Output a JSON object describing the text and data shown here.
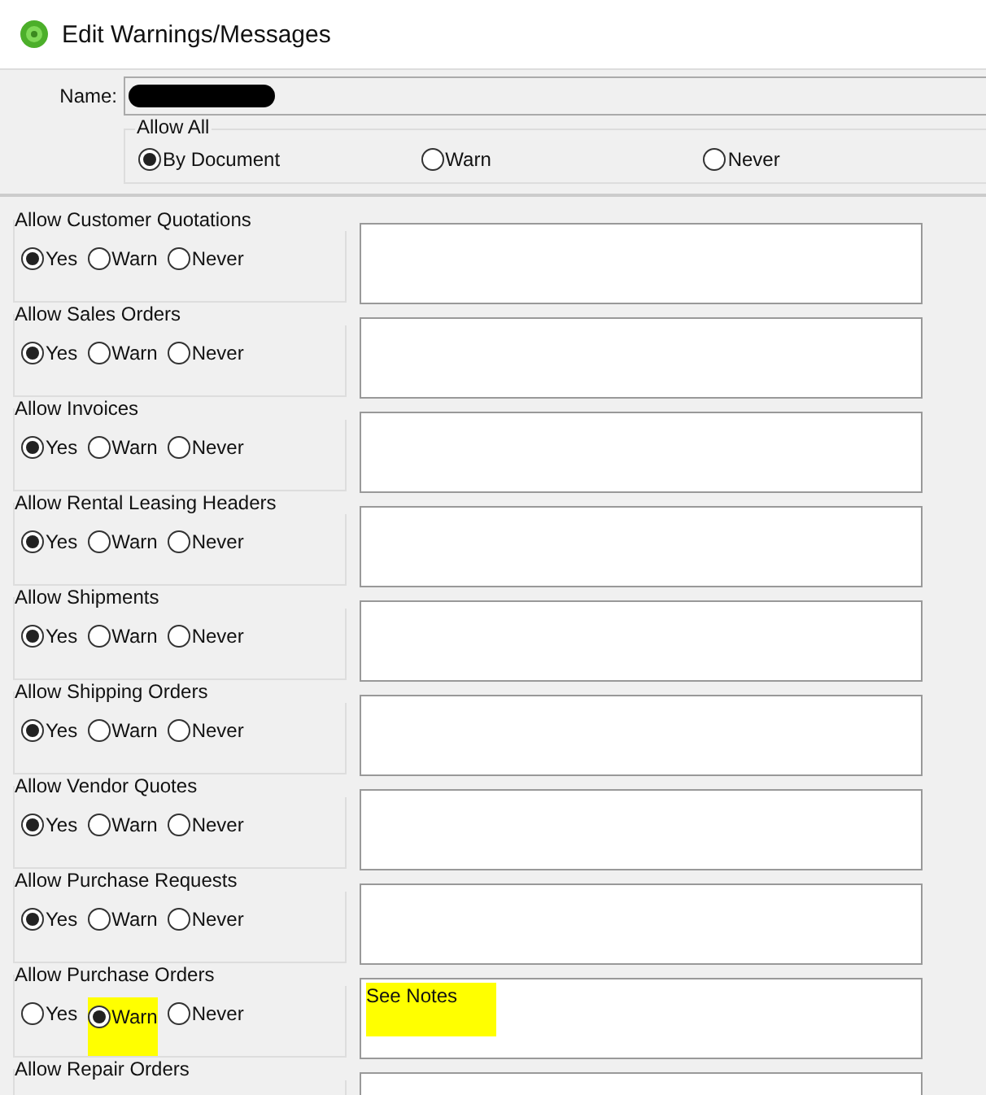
{
  "window": {
    "title": "Edit Warnings/Messages"
  },
  "name_field": {
    "label": "Name:"
  },
  "allow_all": {
    "legend": "Allow All",
    "options": [
      {
        "label": "By Document",
        "selected": true
      },
      {
        "label": "Warn",
        "selected": false
      },
      {
        "label": "Never",
        "selected": false
      }
    ]
  },
  "documents": [
    {
      "label": "Allow Customer Quotations",
      "options": [
        {
          "label": "Yes",
          "selected": true
        },
        {
          "label": "Warn",
          "selected": false
        },
        {
          "label": "Never",
          "selected": false
        }
      ]
    },
    {
      "label": "Allow Sales Orders",
      "options": [
        {
          "label": "Yes",
          "selected": true
        },
        {
          "label": "Warn",
          "selected": false
        },
        {
          "label": "Never",
          "selected": false
        }
      ]
    },
    {
      "label": "Allow Invoices",
      "options": [
        {
          "label": "Yes",
          "selected": true
        },
        {
          "label": "Warn",
          "selected": false
        },
        {
          "label": "Never",
          "selected": false
        }
      ]
    },
    {
      "label": "Allow Rental Leasing Headers",
      "options": [
        {
          "label": "Yes",
          "selected": true
        },
        {
          "label": "Warn",
          "selected": false
        },
        {
          "label": "Never",
          "selected": false
        }
      ]
    },
    {
      "label": "Allow Shipments",
      "options": [
        {
          "label": "Yes",
          "selected": true
        },
        {
          "label": "Warn",
          "selected": false
        },
        {
          "label": "Never",
          "selected": false
        }
      ]
    },
    {
      "label": "Allow Shipping Orders",
      "options": [
        {
          "label": "Yes",
          "selected": true
        },
        {
          "label": "Warn",
          "selected": false
        },
        {
          "label": "Never",
          "selected": false
        }
      ]
    },
    {
      "label": "Allow Vendor Quotes",
      "options": [
        {
          "label": "Yes",
          "selected": true
        },
        {
          "label": "Warn",
          "selected": false
        },
        {
          "label": "Never",
          "selected": false
        }
      ]
    },
    {
      "label": "Allow Purchase Requests",
      "options": [
        {
          "label": "Yes",
          "selected": true
        },
        {
          "label": "Warn",
          "selected": false
        },
        {
          "label": "Never",
          "selected": false
        }
      ]
    },
    {
      "label": "Allow Purchase Orders",
      "options": [
        {
          "label": "Yes",
          "selected": false
        },
        {
          "label": "Warn",
          "selected": true,
          "highlighted": true
        },
        {
          "label": "Never",
          "selected": false
        }
      ],
      "message": "See Notes",
      "message_highlighted": true
    },
    {
      "label": "Allow Repair Orders"
    }
  ]
}
